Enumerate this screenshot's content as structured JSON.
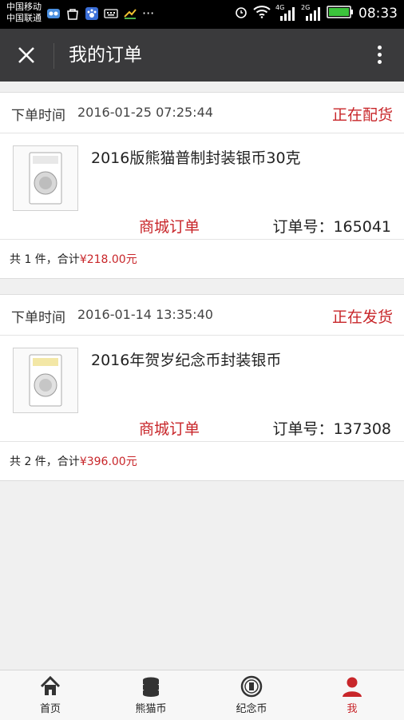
{
  "status_bar": {
    "carrier_1": "中国移动",
    "carrier_2": "中国联通",
    "network_4g": "4G",
    "network_2g": "2G",
    "time": "08:33",
    "more": "···"
  },
  "header": {
    "title": "我的订单",
    "close_icon": "close-icon",
    "more_icon": "more-vertical-icon"
  },
  "orders": [
    {
      "time_label": "下单时间",
      "time": "2016-01-25 07:25:44",
      "status": "正在配货",
      "product_name": "2016版熊猫普制封装银币30克",
      "source": "商城订单",
      "order_no_label": "订单号：",
      "order_no": "165041",
      "summary_prefix": "共 1 件，合计",
      "total": "¥218.00元"
    },
    {
      "time_label": "下单时间",
      "time": "2016-01-14 13:35:40",
      "status": "正在发货",
      "product_name": "2016年贺岁纪念币封装银币",
      "source": "商城订单",
      "order_no_label": "订单号：",
      "order_no": "137308",
      "summary_prefix": "共 2 件，合计",
      "total": "¥396.00元"
    }
  ],
  "bottom_nav": [
    {
      "label": "首页",
      "icon": "home-icon"
    },
    {
      "label": "熊猫币",
      "icon": "coin-stack-icon"
    },
    {
      "label": "纪念币",
      "icon": "commemorative-coin-icon"
    },
    {
      "label": "我",
      "icon": "user-icon",
      "active": true
    }
  ],
  "colors": {
    "accent": "#c8262a",
    "titlebar": "#3a3a3c",
    "background": "#f0f0f0"
  }
}
